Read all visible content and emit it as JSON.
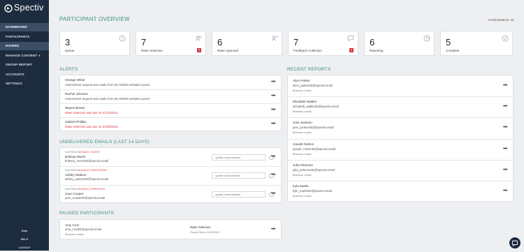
{
  "app": {
    "logo_text": "Spectiv"
  },
  "sidebar": {
    "items": [
      {
        "label": "DASHBOARD"
      },
      {
        "label": "PARTICIPANTS"
      },
      {
        "label": "RATERS"
      },
      {
        "label": "MANAGE CONTENT"
      },
      {
        "label": "GROUP REPORT"
      },
      {
        "label": "ACCOUNTS"
      },
      {
        "label": "SETTINGS"
      }
    ],
    "manage_caret": "▾",
    "user": "Stan",
    "help": "HELP",
    "logout": "LOGOUT"
  },
  "overview": {
    "title": "PARTICIPANT OVERVIEW",
    "credit_balance": "Credit Balance: 31",
    "cards": [
      {
        "value": "3",
        "label": "Queue",
        "icon": "clock-icon"
      },
      {
        "value": "7",
        "label": "Rater Selection",
        "icon": "users-icon",
        "badge": "3"
      },
      {
        "value": "6",
        "label": "Rater Approval",
        "icon": "user-add-icon"
      },
      {
        "value": "7",
        "label": "Feedback Collection",
        "icon": "chat-icon",
        "badge": "4"
      },
      {
        "value": "6",
        "label": "Reporting",
        "icon": "pie-chart-icon"
      },
      {
        "value": "5",
        "label": "Complete",
        "icon": "check-circle-icon"
      }
    ]
  },
  "alerts": {
    "title": "ALERTS",
    "items": [
      {
        "name": "George White",
        "message": "Assessment request was made from the DEMO invitation portal."
      },
      {
        "name": "Rachel Johnson",
        "message": "Assessment request was made from the DEMO invitation portal."
      },
      {
        "name": "Wayne Brown",
        "message": "Rater Selection was due on 01/10/2022."
      },
      {
        "name": "Gabriel Phillips",
        "message": "Rater Selection was due on 01/09/2022."
      }
    ]
  },
  "undelivered": {
    "title": "UNDELIVERED EMAILS (LAST 14 DAYS)",
    "placeholder": "update email address",
    "items": [
      {
        "date": "01/07/2022",
        "status": "BOUNCE | RATER",
        "name": "Brittany Morris",
        "email": "brittany_morris92@spectiv.email"
      },
      {
        "date": "01/07/2022",
        "status": "BOUNCE | PARTICIPANT",
        "name": "Ashley Watson",
        "email": "ashley_watson92@spectiv.email"
      },
      {
        "date": "01/07/2022",
        "status": "BOUNCE | APPROVER",
        "name": "Joan Cooper",
        "email": "joan_cooper92@spectiv.email"
      }
    ]
  },
  "paused": {
    "title": "PAUSED PARTICIPANTS",
    "items": [
      {
        "name": "Amy Cruz",
        "email": "amy_cruz92@spectiv.email",
        "role": "Business Leader",
        "stage": "Rater Selection",
        "paused": "Paused Since: 01/13/2022"
      }
    ]
  },
  "reports": {
    "title": "RECENT REPORTS",
    "items": [
      {
        "name": "Alice Parker",
        "email": "alice_parker92@spectiv.email",
        "role": "Business Leader"
      },
      {
        "name": "Elizabeth Walker",
        "email": "elizabeth_walker92@spectiv.email",
        "role": "Business Leader"
      },
      {
        "name": "Jose Jackson",
        "email": "jose_jackson92@spectiv.email",
        "role": "Business Leader"
      },
      {
        "name": "Joseph Nelson",
        "email": "joseph_nelson92@spectiv.email",
        "role": "Business Leader"
      },
      {
        "name": "Julia Peterson",
        "email": "julia_peterson92@spectiv.email",
        "role": "Business Leader"
      },
      {
        "name": "Kyle Martin",
        "email": "kyle_martin92@spectiv.email",
        "role": "Business Leader"
      }
    ]
  },
  "menu_glyph": "•••",
  "colors": {
    "sidebar": "#1d2b3f",
    "accent": "#3f8f7d",
    "alert": "#d9363e"
  }
}
